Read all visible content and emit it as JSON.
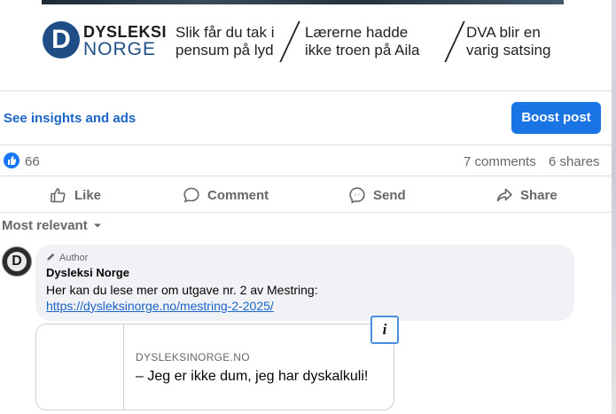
{
  "banner": {
    "logo_top": "DYSLEKSI",
    "logo_bottom": "NORGE",
    "logo_letter": "D",
    "headlines": [
      "Slik får du tak i\npensum på lyd",
      "Lærerne hadde\nikke troen på Aila",
      "DVA blir en\nvarig satsing"
    ]
  },
  "toolbar": {
    "insights_label": "See insights and ads",
    "boost_label": "Boost post"
  },
  "reactions": {
    "like_count": "66",
    "comments": "7 comments",
    "shares": "6 shares"
  },
  "actions": {
    "like": "Like",
    "comment": "Comment",
    "send": "Send",
    "share": "Share"
  },
  "sort": {
    "label": "Most relevant"
  },
  "comment": {
    "avatar_letter": "D",
    "badge": "Author",
    "name": "Dysleksi Norge",
    "text": "Her kan du lese mer om utgave nr. 2 av Mestring:",
    "link": "https://dysleksinorge.no/mestring-2-2025/",
    "preview_domain": "DYSLEKSINORGE.NO",
    "preview_title": "– Jeg er ikke dum, jeg har dyskalkuli!",
    "info_label": "i"
  },
  "colors": {
    "accent": "#1b74e4",
    "link": "#1b64c8",
    "muted": "#65676b"
  }
}
